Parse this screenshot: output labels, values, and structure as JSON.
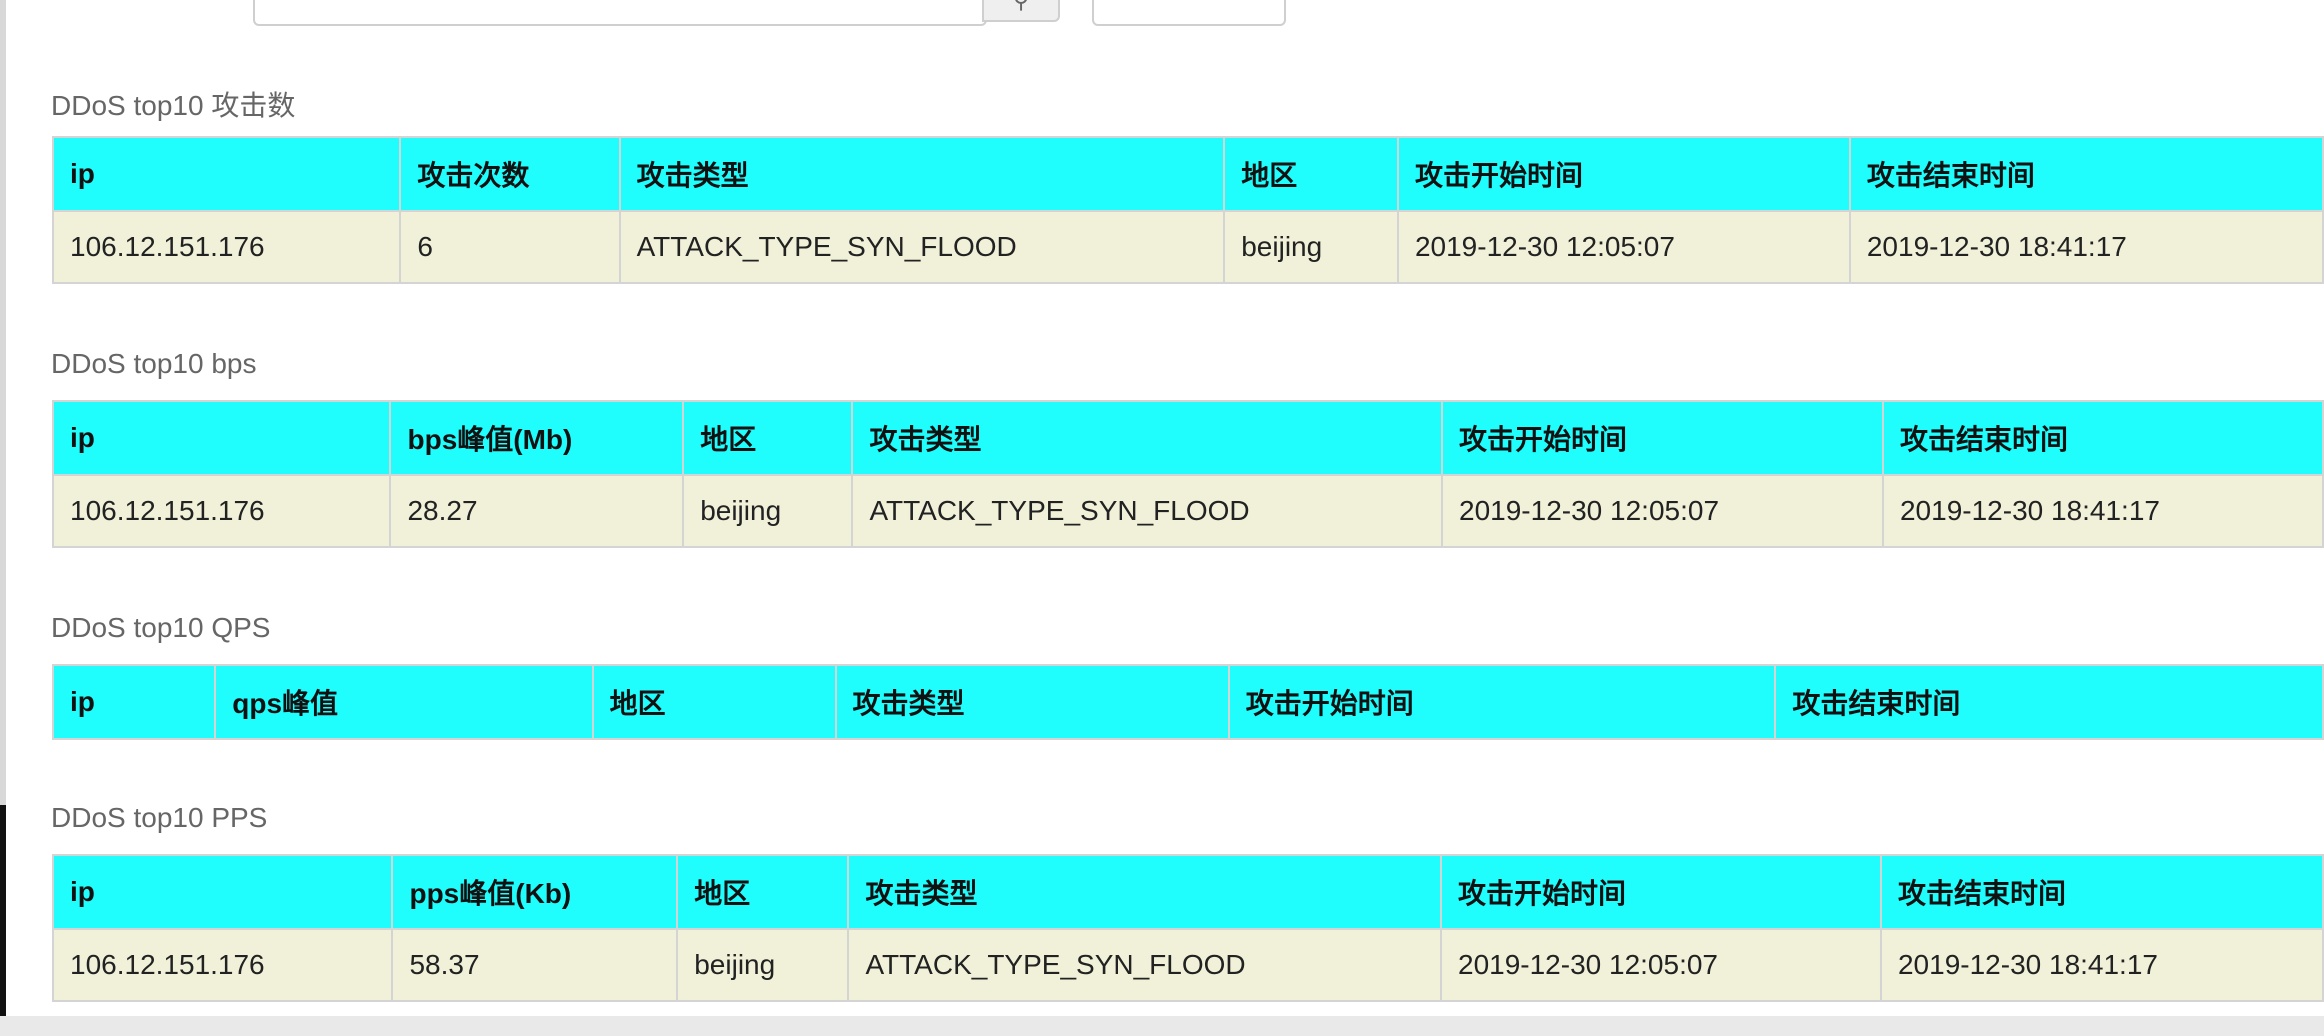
{
  "toolbar": {
    "search_button_glyph": "⚲"
  },
  "sections": [
    {
      "title": "DDoS top10 攻击数",
      "headers": [
        "ip",
        "攻击次数",
        "攻击类型",
        "地区",
        "攻击开始时间",
        "攻击结束时间"
      ],
      "rows": [
        [
          "106.12.151.176",
          "6",
          "ATTACK_TYPE_SYN_FLOOD",
          "beijing",
          "2019-12-30 12:05:07",
          "2019-12-30 18:41:17"
        ]
      ]
    },
    {
      "title": "DDoS top10 bps",
      "headers": [
        "ip",
        "bps峰值(Mb)",
        "地区",
        "攻击类型",
        "攻击开始时间",
        "攻击结束时间"
      ],
      "rows": [
        [
          "106.12.151.176",
          "28.27",
          "beijing",
          "ATTACK_TYPE_SYN_FLOOD",
          "2019-12-30 12:05:07",
          "2019-12-30 18:41:17"
        ]
      ]
    },
    {
      "title": "DDoS top10 QPS",
      "headers": [
        "ip",
        "qps峰值",
        "地区",
        "攻击类型",
        "攻击开始时间",
        "攻击结束时间"
      ],
      "rows": []
    },
    {
      "title": "DDoS top10 PPS",
      "headers": [
        "ip",
        "pps峰值(Kb)",
        "地区",
        "攻击类型",
        "攻击开始时间",
        "攻击结束时间"
      ],
      "rows": [
        [
          "106.12.151.176",
          "58.37",
          "beijing",
          "ATTACK_TYPE_SYN_FLOOD",
          "2019-12-30 12:05:07",
          "2019-12-30 18:41:17"
        ]
      ]
    }
  ],
  "colors": {
    "header_bg": "#1ffdfd",
    "row_bg": "#f1f0d8",
    "border": "#d4d4d4",
    "title_text": "#666666"
  }
}
